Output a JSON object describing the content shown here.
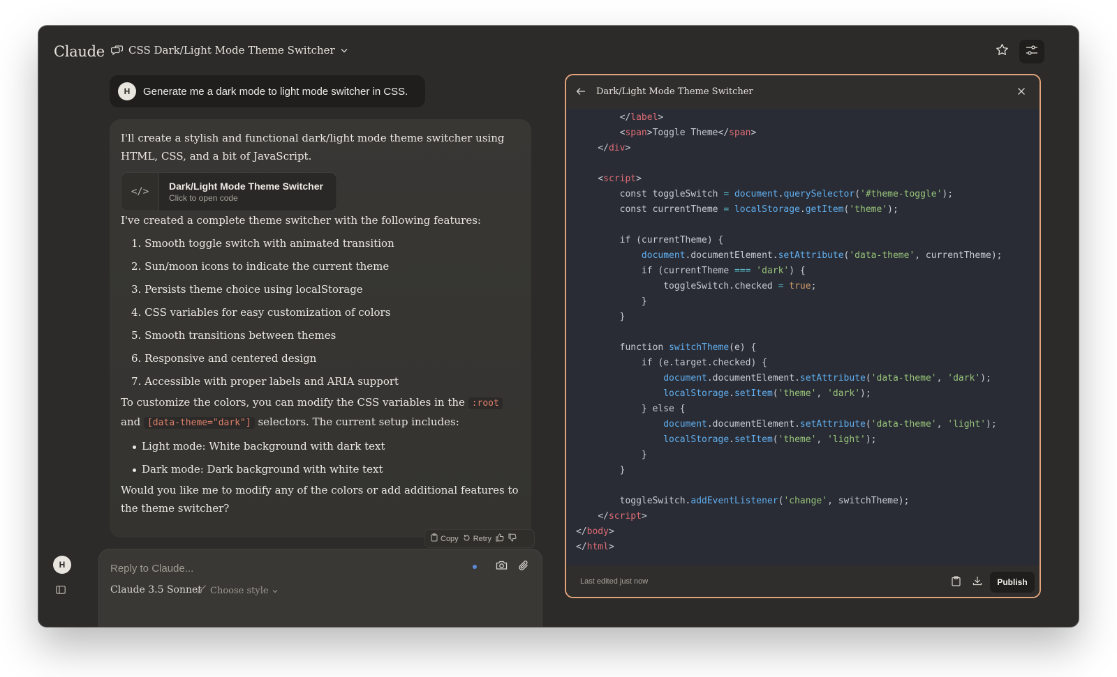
{
  "app": {
    "brand": "Claude",
    "conversation_title": "CSS Dark/Light Mode Theme Switcher"
  },
  "user_message": {
    "avatar_initial": "H",
    "text": "Generate me a dark mode to light mode switcher in CSS."
  },
  "assistant_message": {
    "intro": "I'll create a stylish and functional dark/light mode theme switcher using HTML, CSS, and a bit of JavaScript.",
    "artifact_card": {
      "icon_glyph": "</>",
      "title": "Dark/Light Mode Theme Switcher",
      "subtitle": "Click to open code"
    },
    "features_intro": "I've created a complete theme switcher with the following features:",
    "features": [
      "1. Smooth toggle switch with animated transition",
      "2. Sun/moon icons to indicate the current theme",
      "3. Persists theme choice using localStorage",
      "4. CSS variables for easy customization of colors",
      "5. Smooth transitions between themes",
      "6. Responsive and centered design",
      "7. Accessible with proper labels and ARIA support"
    ],
    "customize": {
      "before": "To customize the colors, you can modify the CSS variables in the ",
      "code1": ":root",
      "middle": " and ",
      "code2": "[data-theme=\"dark\"]",
      "after": " selectors. The current setup includes:"
    },
    "modes": [
      "Light mode: White background with dark text",
      "Dark mode: Dark background with white text"
    ],
    "question": "Would you like me to modify any of the colors or add additional features to the theme switcher?"
  },
  "message_actions": {
    "copy": "Copy",
    "retry": "Retry"
  },
  "composer": {
    "avatar_initial": "H",
    "placeholder": "Reply to Claude...",
    "model": "Claude 3.5 Sonnet",
    "style": "Choose style"
  },
  "artifact": {
    "title": "Dark/Light Mode Theme Switcher",
    "footer_status": "Last edited just now",
    "publish_label": "Publish",
    "code_lines": [
      [
        [
          "plain",
          "        "
        ],
        [
          "punct",
          "</"
        ],
        [
          "tag",
          "label"
        ],
        [
          "punct",
          ">"
        ]
      ],
      [
        [
          "plain",
          "        "
        ],
        [
          "punct",
          "<"
        ],
        [
          "tag",
          "span"
        ],
        [
          "punct",
          ">"
        ],
        [
          "plain",
          "Toggle Theme"
        ],
        [
          "punct",
          "</"
        ],
        [
          "tag",
          "span"
        ],
        [
          "punct",
          ">"
        ]
      ],
      [
        [
          "plain",
          "    "
        ],
        [
          "punct",
          "</"
        ],
        [
          "tag",
          "div"
        ],
        [
          "punct",
          ">"
        ]
      ],
      [
        [
          "plain",
          ""
        ]
      ],
      [
        [
          "plain",
          "    "
        ],
        [
          "punct",
          "<"
        ],
        [
          "tag",
          "script"
        ],
        [
          "punct",
          ">"
        ]
      ],
      [
        [
          "plain",
          "        const toggleSwitch "
        ],
        [
          "op",
          "="
        ],
        [
          "plain",
          " "
        ],
        [
          "fn",
          "document"
        ],
        [
          "plain",
          "."
        ],
        [
          "fn",
          "querySelector"
        ],
        [
          "plain",
          "("
        ],
        [
          "str",
          "'#theme-toggle'"
        ],
        [
          "plain",
          ");"
        ]
      ],
      [
        [
          "plain",
          "        const currentTheme "
        ],
        [
          "op",
          "="
        ],
        [
          "plain",
          " "
        ],
        [
          "fn",
          "localStorage"
        ],
        [
          "plain",
          "."
        ],
        [
          "fn",
          "getItem"
        ],
        [
          "plain",
          "("
        ],
        [
          "str",
          "'theme'"
        ],
        [
          "plain",
          ");"
        ]
      ],
      [
        [
          "plain",
          ""
        ]
      ],
      [
        [
          "plain",
          "        if (currentTheme) {"
        ]
      ],
      [
        [
          "plain",
          "            "
        ],
        [
          "fn",
          "document"
        ],
        [
          "plain",
          ".documentElement."
        ],
        [
          "fn",
          "setAttribute"
        ],
        [
          "plain",
          "("
        ],
        [
          "str",
          "'data-theme'"
        ],
        [
          "plain",
          ", currentTheme);"
        ]
      ],
      [
        [
          "plain",
          "            if (currentTheme "
        ],
        [
          "op",
          "==="
        ],
        [
          "plain",
          " "
        ],
        [
          "str",
          "'dark'"
        ],
        [
          "plain",
          ") {"
        ]
      ],
      [
        [
          "plain",
          "                toggleSwitch.checked "
        ],
        [
          "op",
          "="
        ],
        [
          "plain",
          " "
        ],
        [
          "num",
          "true"
        ],
        [
          "plain",
          ";"
        ]
      ],
      [
        [
          "plain",
          "            }"
        ]
      ],
      [
        [
          "plain",
          "        }"
        ]
      ],
      [
        [
          "plain",
          ""
        ]
      ],
      [
        [
          "plain",
          "        function "
        ],
        [
          "fn",
          "switchTheme"
        ],
        [
          "plain",
          "(e) {"
        ]
      ],
      [
        [
          "plain",
          "            if (e.target.checked) {"
        ]
      ],
      [
        [
          "plain",
          "                "
        ],
        [
          "fn",
          "document"
        ],
        [
          "plain",
          ".documentElement."
        ],
        [
          "fn",
          "setAttribute"
        ],
        [
          "plain",
          "("
        ],
        [
          "str",
          "'data-theme'"
        ],
        [
          "plain",
          ", "
        ],
        [
          "str",
          "'dark'"
        ],
        [
          "plain",
          ");"
        ]
      ],
      [
        [
          "plain",
          "                "
        ],
        [
          "fn",
          "localStorage"
        ],
        [
          "plain",
          "."
        ],
        [
          "fn",
          "setItem"
        ],
        [
          "plain",
          "("
        ],
        [
          "str",
          "'theme'"
        ],
        [
          "plain",
          ", "
        ],
        [
          "str",
          "'dark'"
        ],
        [
          "plain",
          ");"
        ]
      ],
      [
        [
          "plain",
          "            } else {"
        ]
      ],
      [
        [
          "plain",
          "                "
        ],
        [
          "fn",
          "document"
        ],
        [
          "plain",
          ".documentElement."
        ],
        [
          "fn",
          "setAttribute"
        ],
        [
          "plain",
          "("
        ],
        [
          "str",
          "'data-theme'"
        ],
        [
          "plain",
          ", "
        ],
        [
          "str",
          "'light'"
        ],
        [
          "plain",
          ");"
        ]
      ],
      [
        [
          "plain",
          "                "
        ],
        [
          "fn",
          "localStorage"
        ],
        [
          "plain",
          "."
        ],
        [
          "fn",
          "setItem"
        ],
        [
          "plain",
          "("
        ],
        [
          "str",
          "'theme'"
        ],
        [
          "plain",
          ", "
        ],
        [
          "str",
          "'light'"
        ],
        [
          "plain",
          ");"
        ]
      ],
      [
        [
          "plain",
          "            }"
        ]
      ],
      [
        [
          "plain",
          "        }"
        ]
      ],
      [
        [
          "plain",
          ""
        ]
      ],
      [
        [
          "plain",
          "        toggleSwitch."
        ],
        [
          "fn",
          "addEventListener"
        ],
        [
          "plain",
          "("
        ],
        [
          "str",
          "'change'"
        ],
        [
          "plain",
          ", switchTheme);"
        ]
      ],
      [
        [
          "plain",
          "    "
        ],
        [
          "punct",
          "</"
        ],
        [
          "tag",
          "script"
        ],
        [
          "punct",
          ">"
        ]
      ],
      [
        [
          "punct",
          "</"
        ],
        [
          "tag",
          "body"
        ],
        [
          "punct",
          ">"
        ]
      ],
      [
        [
          "punct",
          "</"
        ],
        [
          "tag",
          "html"
        ],
        [
          "punct",
          ">"
        ]
      ]
    ]
  },
  "icons": {
    "conversation": "chat-bubbles-icon",
    "chevron": "chevron-down-icon",
    "star": "star-icon",
    "settings": "sliders-icon",
    "back": "arrow-left-icon",
    "close": "close-icon",
    "copy": "clipboard-icon",
    "download": "download-icon",
    "camera": "camera-icon",
    "attach": "paperclip-icon",
    "sidebar": "sidebar-toggle-icon",
    "style": "brush-icon"
  },
  "colors": {
    "window_bg": "#2c2b29",
    "panel_border_accent": "#e3a47b",
    "code_bg": "#292c35",
    "inline_code": "#e07f6a"
  }
}
